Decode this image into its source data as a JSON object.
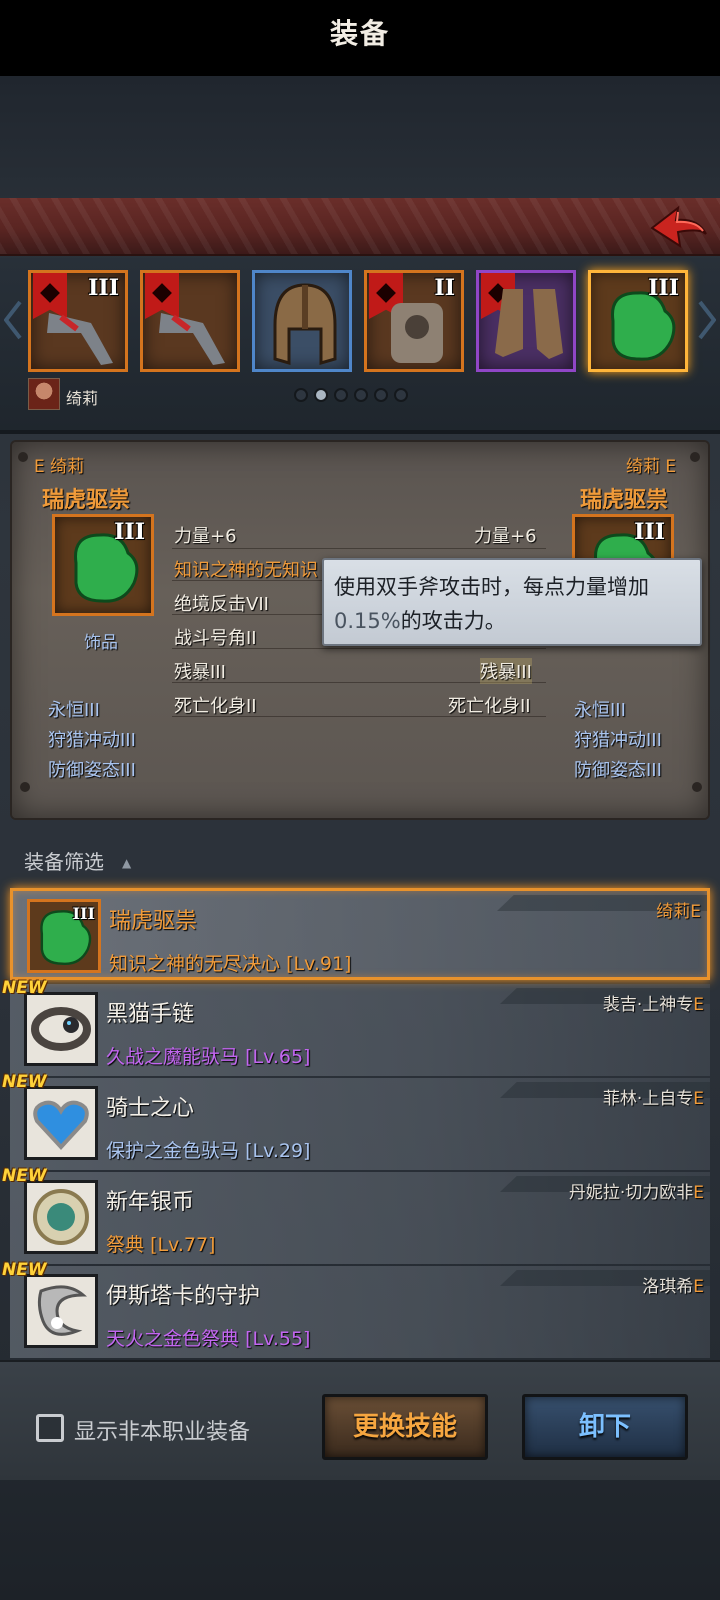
{
  "header": {
    "title": "装备",
    "back_icon": "back-arrow-icon"
  },
  "equipment_slots": [
    {
      "name": "weapon",
      "tier": "III",
      "banner": true,
      "rarity": "orange"
    },
    {
      "name": "weapon-2",
      "tier": "",
      "banner": true,
      "rarity": "orange"
    },
    {
      "name": "helmet",
      "tier": "",
      "banner": false,
      "rarity": "blue"
    },
    {
      "name": "armor",
      "tier": "II",
      "banner": true,
      "rarity": "orange"
    },
    {
      "name": "boots",
      "tier": "",
      "banner": true,
      "rarity": "purple"
    },
    {
      "name": "accessory",
      "tier": "III",
      "banner": false,
      "rarity": "orange",
      "selected": true
    }
  ],
  "owner": {
    "name": "绮莉"
  },
  "page_dots": {
    "count": 6,
    "active": 1
  },
  "compare": {
    "left": {
      "owner": "E 绮莉",
      "item_name": "瑞虎驱祟",
      "tier": "III",
      "type": "饰品",
      "stat": "力量+6",
      "skills": [
        "知识之神的无知识",
        "绝境反击VII",
        "战斗号角II",
        "残暴III",
        "死亡化身II"
      ],
      "extra": [
        "永恒III",
        "狩猎冲动III",
        "防御姿态III"
      ]
    },
    "right": {
      "owner": "绮莉 E",
      "item_name": "瑞虎驱祟",
      "tier": "III",
      "stat": "力量+6",
      "skills": [
        "残暴III",
        "死亡化身II"
      ],
      "extra": [
        "永恒III",
        "狩猎冲动III",
        "防御姿态III"
      ]
    },
    "tooltip": {
      "line1": "使用双手斧攻击时，每点力量增加",
      "pct": "0.15%",
      "line2": "的攻击力。"
    }
  },
  "filter": {
    "label": "装备筛选",
    "caret": "▲"
  },
  "list": [
    {
      "new": false,
      "name": "瑞虎驱祟",
      "skill": "知识之神的无尽决心",
      "level": "[Lv.91]",
      "owner": "绮莉",
      "grade": "E",
      "skill_color": "#f09b3a",
      "selected": true,
      "tier": "III"
    },
    {
      "new": true,
      "name": "黑猫手链",
      "skill": "久战之魔能驮马",
      "level": "[Lv.65]",
      "owner": "裴吉·上神专",
      "grade": "E",
      "skill_color": "#c266f0"
    },
    {
      "new": true,
      "name": "骑士之心",
      "skill": "保护之金色驮马",
      "level": "[Lv.29]",
      "owner": "菲林·上自专",
      "grade": "E",
      "skill_color": "#a9c4ef"
    },
    {
      "new": true,
      "name": "新年银币",
      "skill": "祭典",
      "level": "[Lv.77]",
      "owner": "丹妮拉·切力欧非",
      "grade": "E",
      "skill_color": "#f09b3a"
    },
    {
      "new": true,
      "name": "伊斯塔卡的守护",
      "skill": "天火之金色祭典",
      "level": "[Lv.55]",
      "owner": "洛琪希",
      "grade": "E",
      "skill_color": "#c266f0"
    }
  ],
  "bottom": {
    "checkbox_label": "显示非本职业装备",
    "skill_button": "更换技能",
    "unequip_button": "卸下"
  },
  "new_badge": "NEW"
}
